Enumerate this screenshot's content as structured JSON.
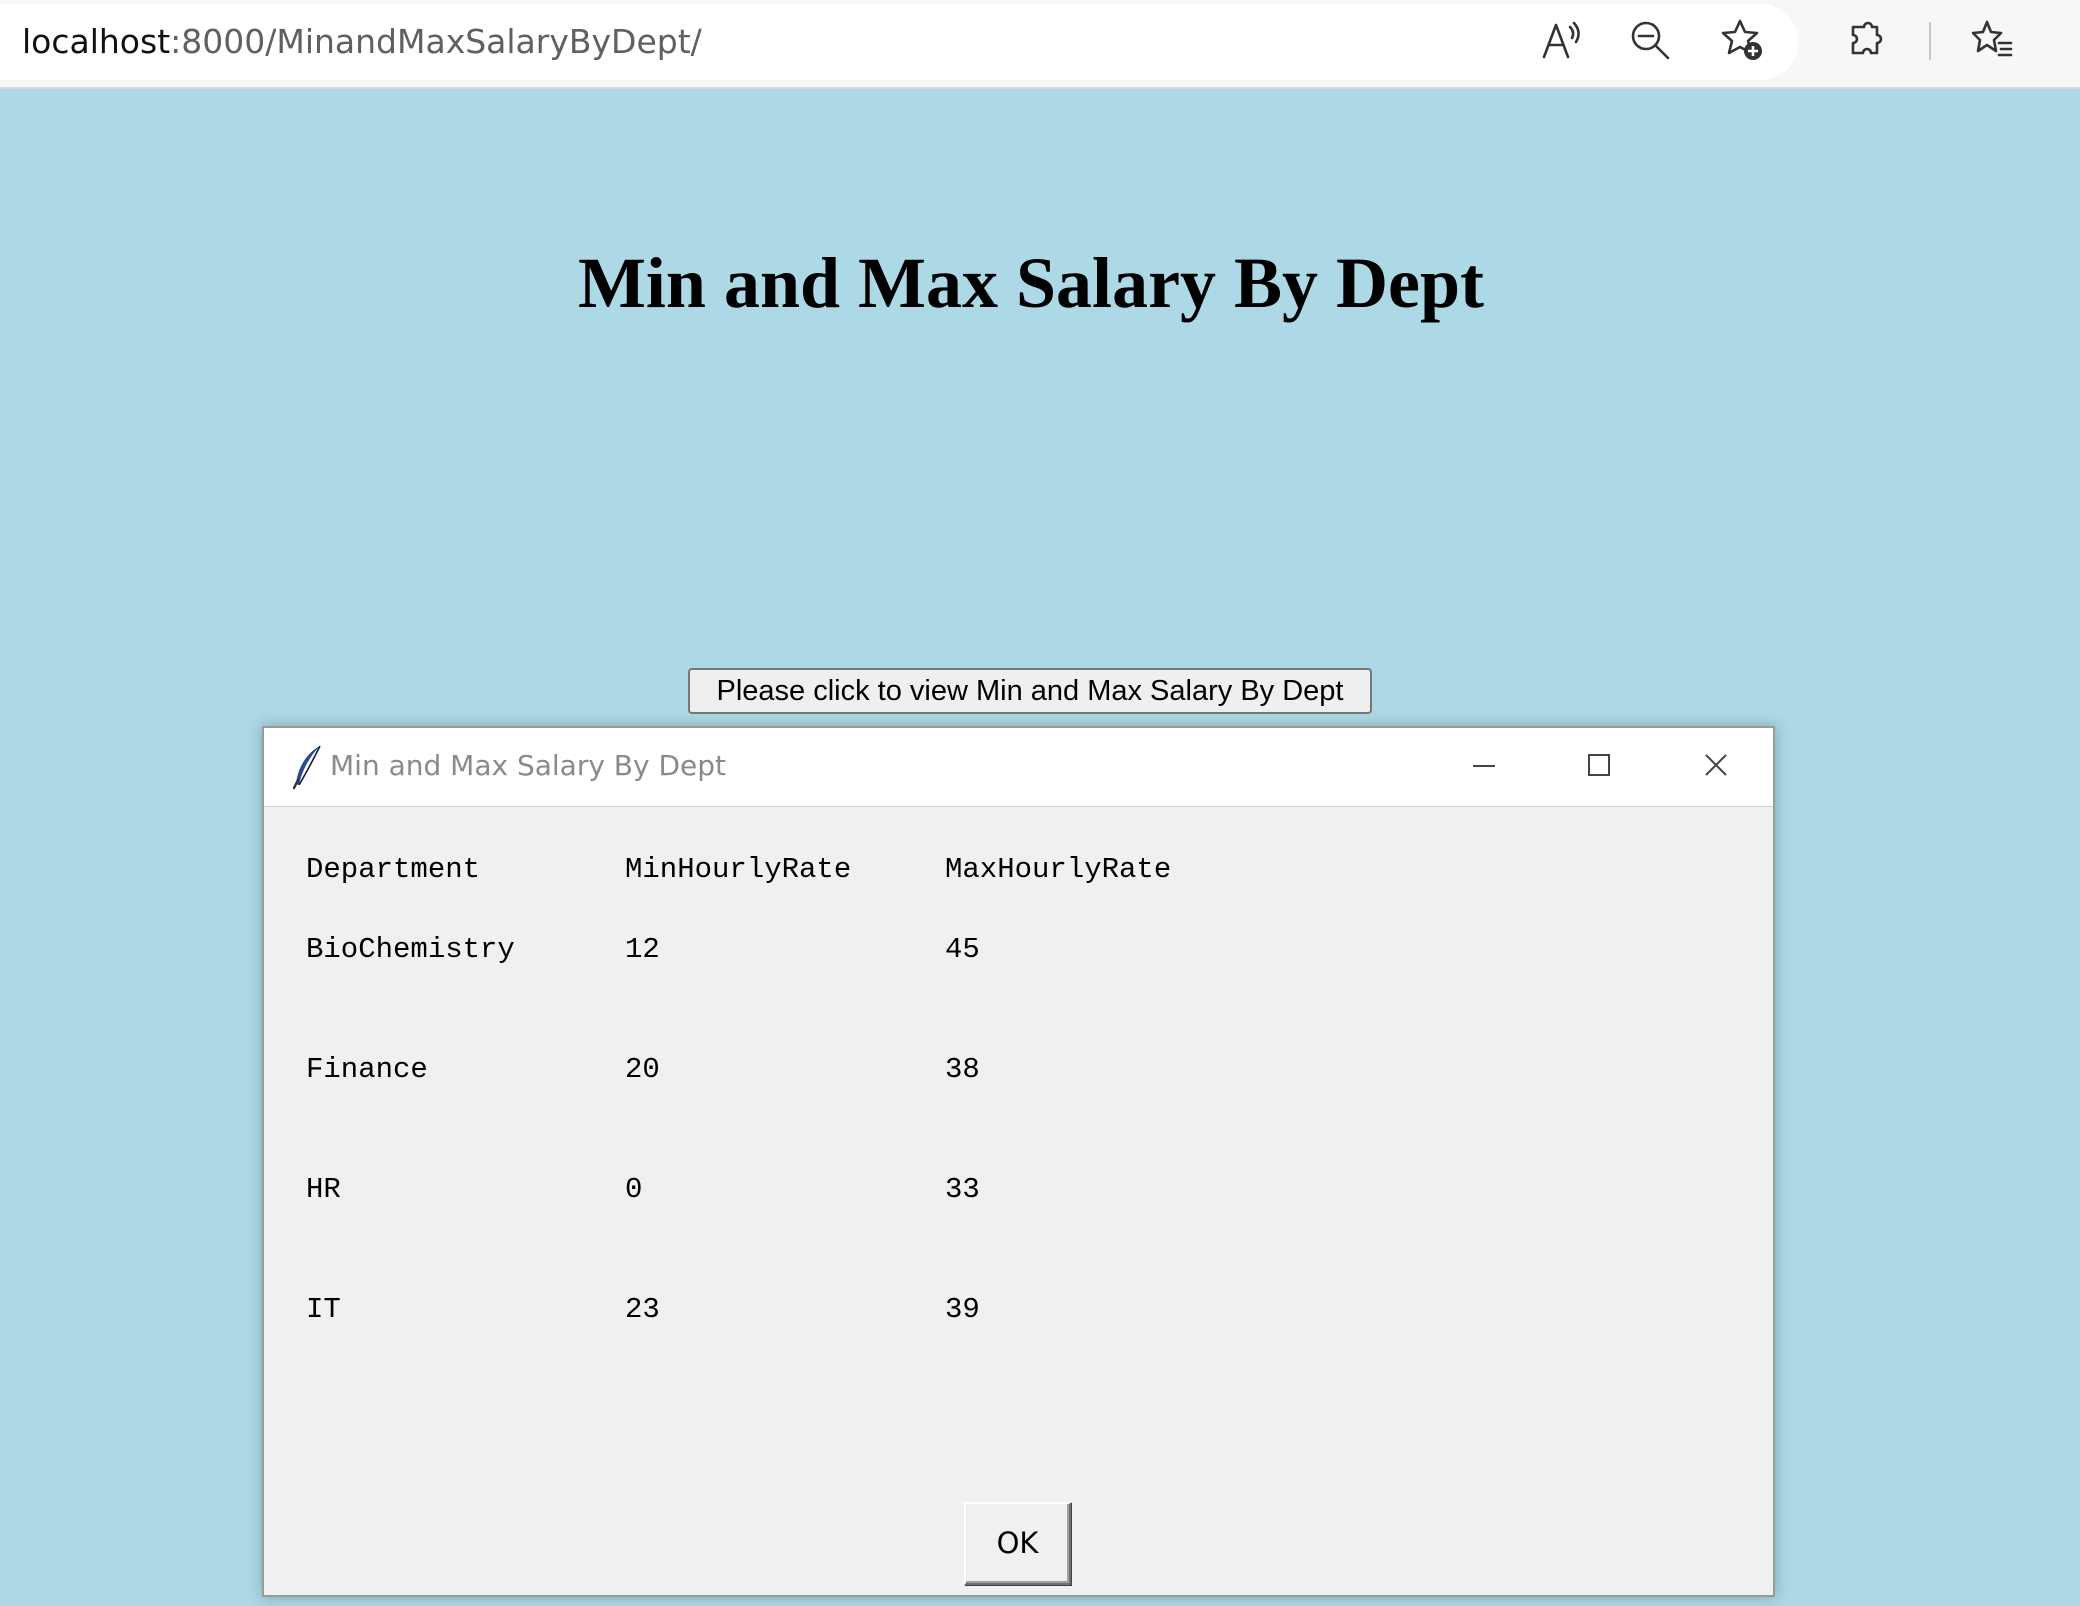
{
  "browser": {
    "url_host": "localhost",
    "url_path": ":8000/MinandMaxSalaryByDept/"
  },
  "page": {
    "title": "Min and Max Salary By Dept",
    "button_label": "Please click to view Min and Max Salary By Dept"
  },
  "dialog": {
    "title": "Min and Max Salary By Dept",
    "columns": [
      "Department",
      "MinHourlyRate",
      "MaxHourlyRate"
    ],
    "rows": [
      [
        "BioChemistry",
        "12",
        "45"
      ],
      [
        "Finance",
        "20",
        "38"
      ],
      [
        "HR",
        "0",
        "33"
      ],
      [
        "IT",
        "23",
        "39"
      ]
    ],
    "ok_label": "OK"
  }
}
